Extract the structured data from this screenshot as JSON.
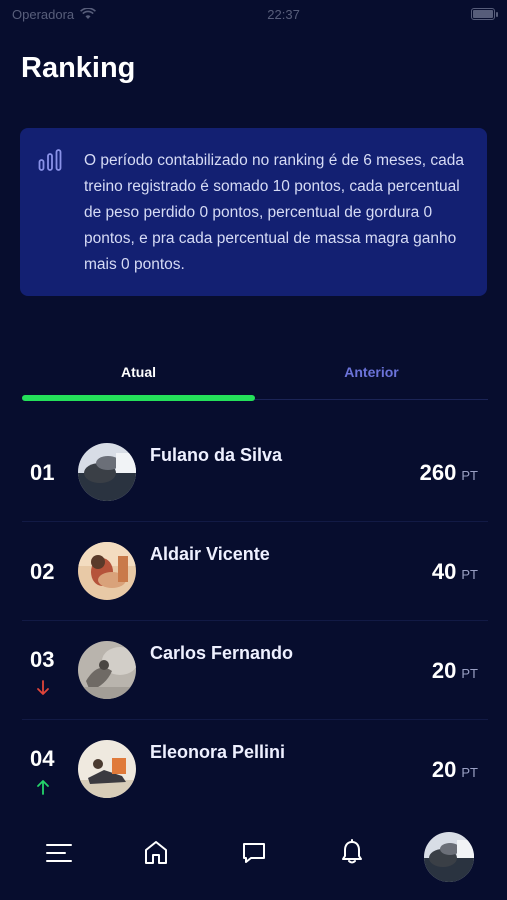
{
  "status": {
    "carrier": "Operadora",
    "time": "22:37"
  },
  "page": {
    "title": "Ranking"
  },
  "info": {
    "text": "O período contabilizado no ranking é de 6 meses, cada treino registrado é somado 10 pontos, cada percentual de peso perdido 0 pontos, percentual de gordura 0 pontos, e pra cada percentual de massa magra ganho mais 0 pontos.",
    "icon": "bar-chart-icon"
  },
  "tabs": [
    {
      "label": "Atual",
      "active": true
    },
    {
      "label": "Anterior",
      "active": false
    }
  ],
  "ranking": [
    {
      "position": "01",
      "name": "Fulano da Silva",
      "points": "260",
      "unit": "PT",
      "trend": "none"
    },
    {
      "position": "02",
      "name": "Aldair Vicente",
      "points": "40",
      "unit": "PT",
      "trend": "none"
    },
    {
      "position": "03",
      "name": "Carlos Fernando",
      "points": "20",
      "unit": "PT",
      "trend": "down"
    },
    {
      "position": "04",
      "name": "Eleonora Pellini",
      "points": "20",
      "unit": "PT",
      "trend": "up"
    }
  ],
  "nav": {
    "items": [
      "menu-icon",
      "home-icon",
      "chat-icon",
      "bell-icon",
      "profile-avatar"
    ]
  },
  "colors": {
    "background": "#070d2e",
    "card": "#132072",
    "accent_green": "#24e05a",
    "tab_inactive": "#6b73d9",
    "trend_down": "#e0453a",
    "trend_up": "#24d46a"
  }
}
